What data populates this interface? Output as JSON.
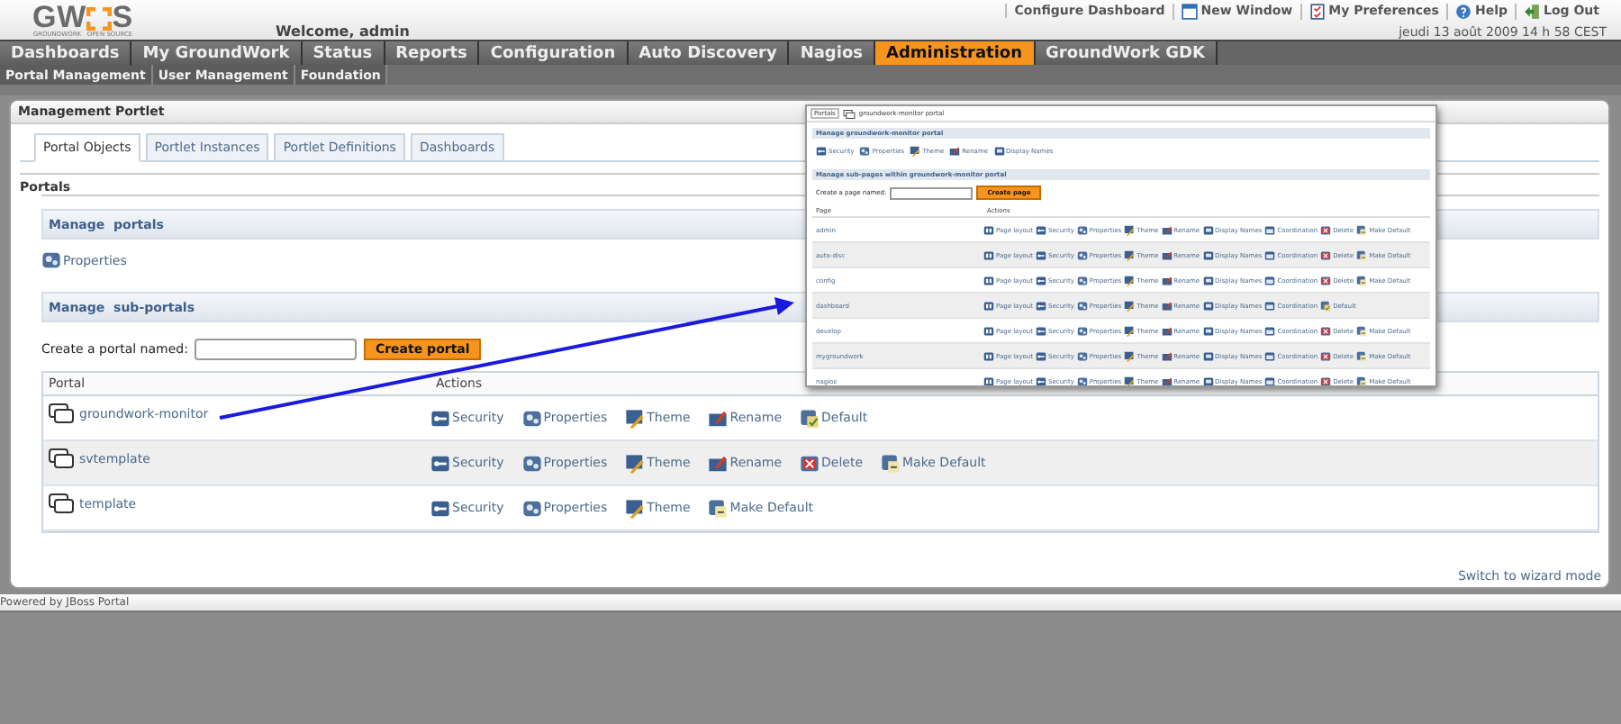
{
  "logo": {
    "left": "GW",
    "right": "S",
    "tagline": "GROUNDWORK   OPEN SOURCE"
  },
  "welcome": "Welcome, admin",
  "top_links": [
    {
      "label": "Configure Dashboard",
      "kind": "none"
    },
    {
      "label": "New Window",
      "kind": "window"
    },
    {
      "label": "My Preferences",
      "kind": "checklist"
    },
    {
      "label": "Help",
      "kind": "help"
    },
    {
      "label": "Log Out",
      "kind": "exit"
    }
  ],
  "date": "jeudi 13 août 2009 14 h 58 CEST",
  "nav": [
    {
      "label": "Dashboards",
      "selected": false
    },
    {
      "label": "My GroundWork",
      "selected": false
    },
    {
      "label": "Status",
      "selected": false
    },
    {
      "label": "Reports",
      "selected": false
    },
    {
      "label": "Configuration",
      "selected": false
    },
    {
      "label": "Auto Discovery",
      "selected": false
    },
    {
      "label": "Nagios",
      "selected": false
    },
    {
      "label": "Administration",
      "selected": true
    },
    {
      "label": "GroundWork GDK",
      "selected": false
    }
  ],
  "subnav": [
    "Portal Management",
    "User Management",
    "Foundation"
  ],
  "portlet": {
    "title": "Management Portlet",
    "tabs": [
      {
        "label": "Portal Objects",
        "selected": true
      },
      {
        "label": "Portlet Instances",
        "selected": false
      },
      {
        "label": "Portlet Definitions",
        "selected": false
      },
      {
        "label": "Dashboards",
        "selected": false
      }
    ],
    "section": "Portals",
    "manage_portals": "Manage  portals",
    "portal_actions": [
      {
        "label": "Properties",
        "kind": "properties"
      }
    ],
    "manage_subportals": "Manage  sub-portals",
    "create_label": "Create a portal named:",
    "create_button": "Create portal",
    "columns": [
      "Portal",
      "Actions"
    ],
    "rows": [
      {
        "name": "groundwork-monitor",
        "actions": [
          {
            "label": "Security",
            "kind": "security"
          },
          {
            "label": "Properties",
            "kind": "properties"
          },
          {
            "label": "Theme",
            "kind": "theme"
          },
          {
            "label": "Rename",
            "kind": "rename"
          },
          {
            "label": "Default",
            "kind": "default"
          }
        ]
      },
      {
        "name": "svtemplate",
        "actions": [
          {
            "label": "Security",
            "kind": "security"
          },
          {
            "label": "Properties",
            "kind": "properties"
          },
          {
            "label": "Theme",
            "kind": "theme"
          },
          {
            "label": "Rename",
            "kind": "rename"
          },
          {
            "label": "Delete",
            "kind": "delete"
          },
          {
            "label": "Make Default",
            "kind": "make-default"
          }
        ]
      },
      {
        "name": "template",
        "actions": [
          {
            "label": "Security",
            "kind": "security"
          },
          {
            "label": "Properties",
            "kind": "properties"
          },
          {
            "label": "Theme",
            "kind": "theme"
          },
          {
            "label": "Make Default",
            "kind": "make-default"
          }
        ]
      }
    ],
    "switch_link": "Switch to wizard mode"
  },
  "footer": "Powered by JBoss Portal",
  "inset": {
    "crumb": "Portals",
    "crumb_page": "groundwork-monitor portal",
    "manage": "Manage groundwork-monitor portal",
    "actions": [
      {
        "label": "Security",
        "kind": "security"
      },
      {
        "label": "Properties",
        "kind": "properties"
      },
      {
        "label": "Theme",
        "kind": "theme"
      },
      {
        "label": "Rename",
        "kind": "rename"
      },
      {
        "label": "Display Names",
        "kind": "display-names"
      }
    ],
    "manage_sub": "Manage sub-pages within groundwork-monitor portal",
    "create_label": "Create a page named:",
    "create_button": "Create page",
    "columns": [
      "Page",
      "Actions"
    ],
    "rows": [
      {
        "name": "admin",
        "actions": [
          {
            "label": "Page layout",
            "kind": "page-layout"
          },
          {
            "label": "Security",
            "kind": "security"
          },
          {
            "label": "Properties",
            "kind": "properties"
          },
          {
            "label": "Theme",
            "kind": "theme"
          },
          {
            "label": "Rename",
            "kind": "rename"
          },
          {
            "label": "Display Names",
            "kind": "display-names"
          },
          {
            "label": "Coordination",
            "kind": "coordination"
          },
          {
            "label": "Delete",
            "kind": "delete"
          },
          {
            "label": "Make Default",
            "kind": "make-default"
          }
        ]
      },
      {
        "name": "auto-disc",
        "actions": [
          {
            "label": "Page layout",
            "kind": "page-layout"
          },
          {
            "label": "Security",
            "kind": "security"
          },
          {
            "label": "Properties",
            "kind": "properties"
          },
          {
            "label": "Theme",
            "kind": "theme"
          },
          {
            "label": "Rename",
            "kind": "rename"
          },
          {
            "label": "Display Names",
            "kind": "display-names"
          },
          {
            "label": "Coordination",
            "kind": "coordination"
          },
          {
            "label": "Delete",
            "kind": "delete"
          },
          {
            "label": "Make Default",
            "kind": "make-default"
          }
        ]
      },
      {
        "name": "config",
        "actions": [
          {
            "label": "Page layout",
            "kind": "page-layout"
          },
          {
            "label": "Security",
            "kind": "security"
          },
          {
            "label": "Properties",
            "kind": "properties"
          },
          {
            "label": "Theme",
            "kind": "theme"
          },
          {
            "label": "Rename",
            "kind": "rename"
          },
          {
            "label": "Display Names",
            "kind": "display-names"
          },
          {
            "label": "Coordination",
            "kind": "coordination"
          },
          {
            "label": "Delete",
            "kind": "delete"
          },
          {
            "label": "Make Default",
            "kind": "make-default"
          }
        ]
      },
      {
        "name": "dashboard",
        "actions": [
          {
            "label": "Page layout",
            "kind": "page-layout"
          },
          {
            "label": "Security",
            "kind": "security"
          },
          {
            "label": "Properties",
            "kind": "properties"
          },
          {
            "label": "Theme",
            "kind": "theme"
          },
          {
            "label": "Rename",
            "kind": "rename"
          },
          {
            "label": "Display Names",
            "kind": "display-names"
          },
          {
            "label": "Coordination",
            "kind": "coordination"
          },
          {
            "label": "Default",
            "kind": "default"
          }
        ]
      },
      {
        "name": "develop",
        "actions": [
          {
            "label": "Page layout",
            "kind": "page-layout"
          },
          {
            "label": "Security",
            "kind": "security"
          },
          {
            "label": "Properties",
            "kind": "properties"
          },
          {
            "label": "Theme",
            "kind": "theme"
          },
          {
            "label": "Rename",
            "kind": "rename"
          },
          {
            "label": "Display Names",
            "kind": "display-names"
          },
          {
            "label": "Coordination",
            "kind": "coordination"
          },
          {
            "label": "Delete",
            "kind": "delete"
          },
          {
            "label": "Make Default",
            "kind": "make-default"
          }
        ]
      },
      {
        "name": "mygroundwork",
        "actions": [
          {
            "label": "Page layout",
            "kind": "page-layout"
          },
          {
            "label": "Security",
            "kind": "security"
          },
          {
            "label": "Properties",
            "kind": "properties"
          },
          {
            "label": "Theme",
            "kind": "theme"
          },
          {
            "label": "Rename",
            "kind": "rename"
          },
          {
            "label": "Display Names",
            "kind": "display-names"
          },
          {
            "label": "Coordination",
            "kind": "coordination"
          },
          {
            "label": "Delete",
            "kind": "delete"
          },
          {
            "label": "Make Default",
            "kind": "make-default"
          }
        ]
      },
      {
        "name": "nagios",
        "actions": [
          {
            "label": "Page layout",
            "kind": "page-layout"
          },
          {
            "label": "Security",
            "kind": "security"
          },
          {
            "label": "Properties",
            "kind": "properties"
          },
          {
            "label": "Theme",
            "kind": "theme"
          },
          {
            "label": "Rename",
            "kind": "rename"
          },
          {
            "label": "Display Names",
            "kind": "display-names"
          },
          {
            "label": "Coordination",
            "kind": "coordination"
          },
          {
            "label": "Delete",
            "kind": "delete"
          },
          {
            "label": "Make Default",
            "kind": "make-default"
          }
        ]
      }
    ]
  }
}
